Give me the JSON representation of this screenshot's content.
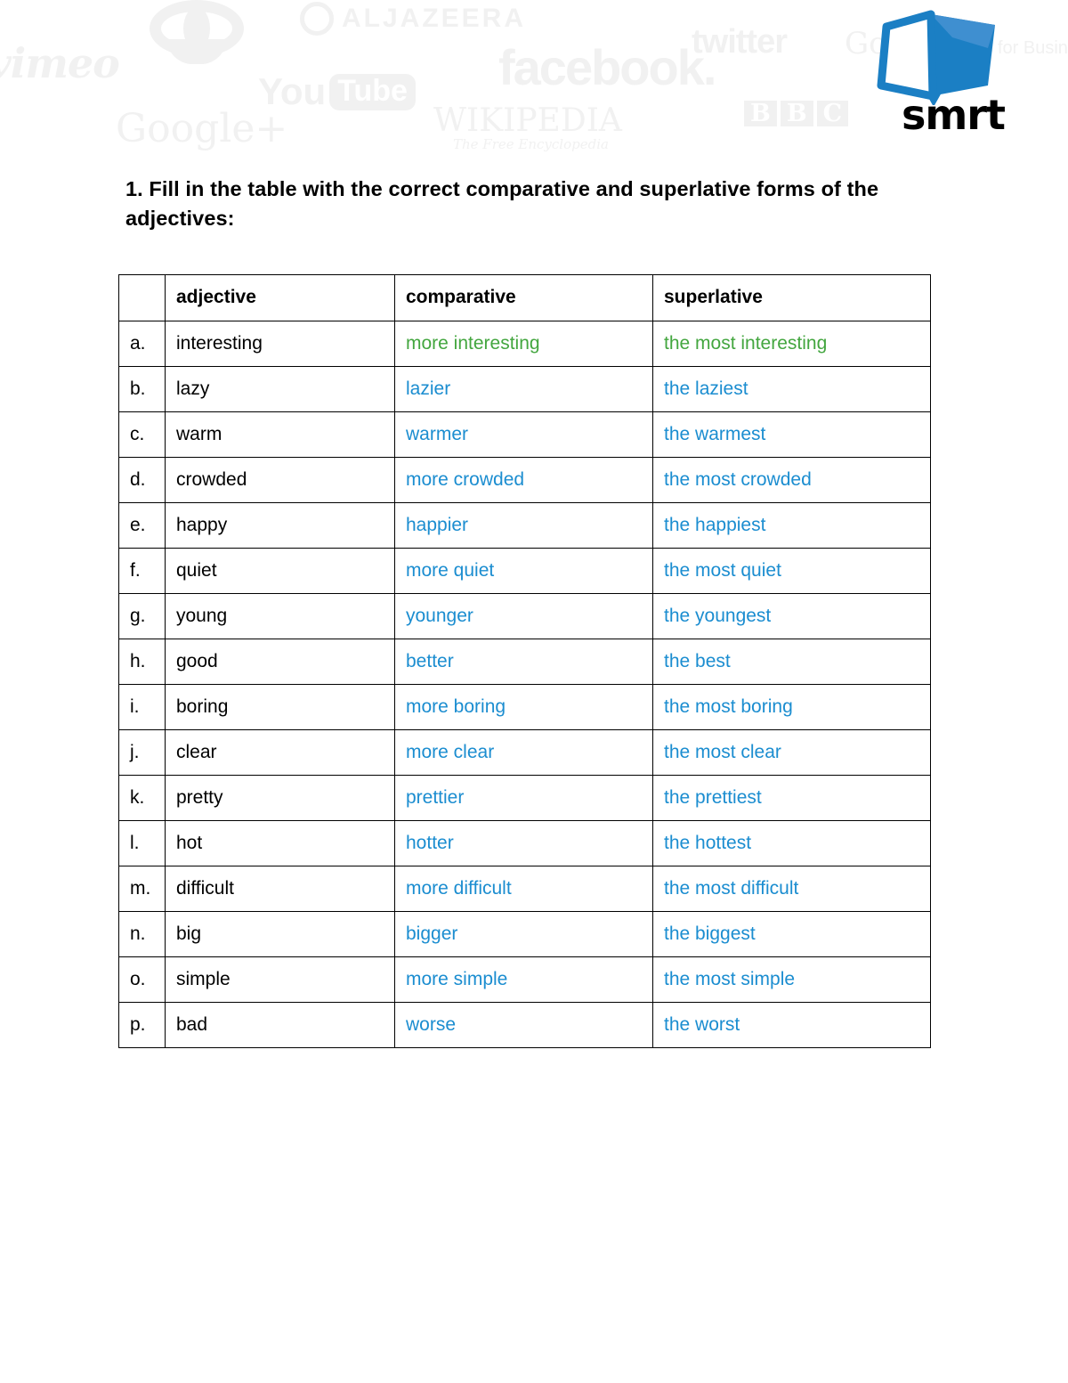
{
  "header": {
    "watermarks": [
      {
        "name": "vimeo",
        "label": "vimeo"
      },
      {
        "name": "cbc",
        "label": ""
      },
      {
        "name": "aljazeera",
        "label": "ALJAZEERA"
      },
      {
        "name": "youtube",
        "label_you": "You",
        "label_tube": "Tube"
      },
      {
        "name": "googleplus",
        "label": "Google+"
      },
      {
        "name": "facebook",
        "label": "facebook."
      },
      {
        "name": "wikipedia",
        "label": "WIKIPEDIA",
        "sublabel": "The Free Encyclopedia"
      },
      {
        "name": "twitter",
        "label": "twitter"
      },
      {
        "name": "bbc",
        "letters": [
          "B",
          "B",
          "C"
        ]
      },
      {
        "name": "google-apps",
        "label": "Google",
        "sublabel": "Apps for Business"
      }
    ],
    "brand": {
      "wordmark": "smrt",
      "logo_icon": "open-book-icon",
      "color_primary": "#1b7fc4",
      "color_secondary": "#3f8fd0"
    }
  },
  "instruction": {
    "text": "1. Fill in the table with the correct comparative and superlative forms of the adjectives:"
  },
  "table": {
    "columns": [
      "",
      "adjective",
      "comparative",
      "superlative"
    ],
    "rows": [
      {
        "letter": "a.",
        "adjective": "interesting",
        "comparative": "more interesting",
        "superlative": "the most interesting",
        "color": "green"
      },
      {
        "letter": "b.",
        "adjective": "lazy",
        "comparative": "lazier",
        "superlative": "the laziest",
        "color": "blue"
      },
      {
        "letter": "c.",
        "adjective": "warm",
        "comparative": "warmer",
        "superlative": "the warmest",
        "color": "blue"
      },
      {
        "letter": "d.",
        "adjective": "crowded",
        "comparative": "more crowded",
        "superlative": "the most crowded",
        "color": "blue"
      },
      {
        "letter": "e.",
        "adjective": "happy",
        "comparative": "happier",
        "superlative": "the happiest",
        "color": "blue"
      },
      {
        "letter": "f.",
        "adjective": "quiet",
        "comparative": "more quiet",
        "superlative": "the most quiet",
        "color": "blue"
      },
      {
        "letter": "g.",
        "adjective": "young",
        "comparative": "younger",
        "superlative": "the youngest",
        "color": "blue"
      },
      {
        "letter": "h.",
        "adjective": "good",
        "comparative": "better",
        "superlative": "the best",
        "color": "blue"
      },
      {
        "letter": "i.",
        "adjective": "boring",
        "comparative": "more boring",
        "superlative": "the most boring",
        "color": "blue"
      },
      {
        "letter": "j.",
        "adjective": "clear",
        "comparative": "more clear",
        "superlative": "the most clear",
        "color": "blue"
      },
      {
        "letter": "k.",
        "adjective": "pretty",
        "comparative": "prettier",
        "superlative": "the prettiest",
        "color": "blue"
      },
      {
        "letter": "l.",
        "adjective": "hot",
        "comparative": "hotter",
        "superlative": "the hottest",
        "color": "blue"
      },
      {
        "letter": "m.",
        "adjective": "difficult",
        "comparative": "more difficult",
        "superlative": "the most difficult",
        "color": "blue"
      },
      {
        "letter": "n.",
        "adjective": "big",
        "comparative": "bigger",
        "superlative": "the biggest",
        "color": "blue"
      },
      {
        "letter": "o.",
        "adjective": "simple",
        "comparative": "more simple",
        "superlative": "the most simple",
        "color": "blue"
      },
      {
        "letter": "p.",
        "adjective": "bad",
        "comparative": "worse",
        "superlative": "the worst",
        "color": "blue"
      }
    ],
    "answer_colors": {
      "blue": "#1b8dd0",
      "green": "#43a63f"
    }
  }
}
